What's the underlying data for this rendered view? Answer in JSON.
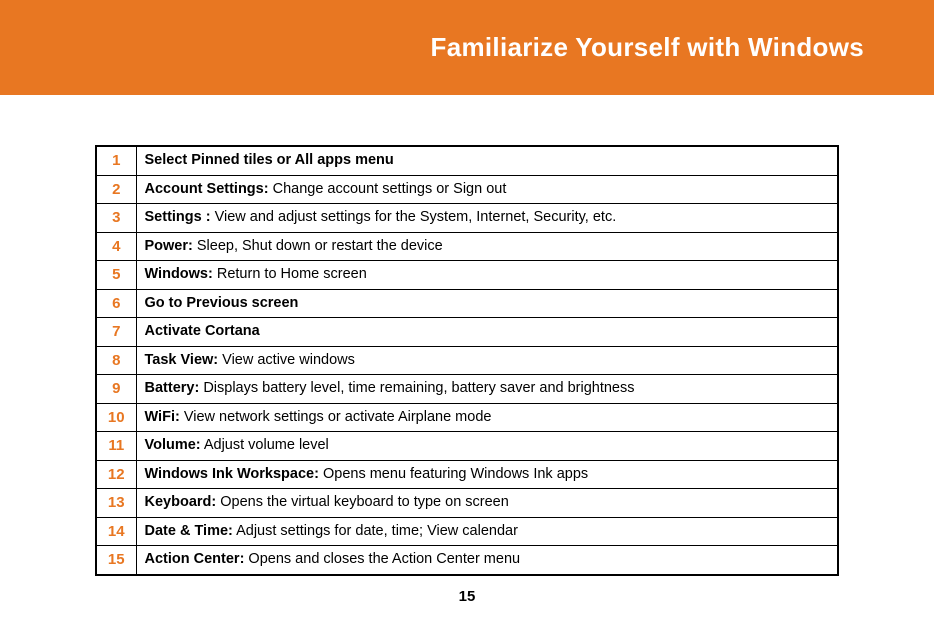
{
  "header": {
    "title": "Familiarize Yourself with Windows"
  },
  "rows": [
    {
      "num": "1",
      "bold": "Select Pinned tiles or All apps menu",
      "rest": ""
    },
    {
      "num": "2",
      "bold": "Account Settings:",
      "rest": " Change account settings or Sign out"
    },
    {
      "num": "3",
      "bold": "Settings :",
      "rest": " View and adjust settings for the System, Internet, Security, etc."
    },
    {
      "num": "4",
      "bold": "Power:",
      "rest": " Sleep, Shut down or restart the device"
    },
    {
      "num": "5",
      "bold": "Windows:",
      "rest": " Return to Home screen"
    },
    {
      "num": "6",
      "bold": "Go to Previous screen",
      "rest": ""
    },
    {
      "num": "7",
      "bold": "Activate Cortana",
      "rest": ""
    },
    {
      "num": "8",
      "bold": "Task View:",
      "rest": " View active windows"
    },
    {
      "num": "9",
      "bold": "Battery:",
      "rest": " Displays battery level, time remaining, battery saver and brightness"
    },
    {
      "num": "10",
      "bold": "WiFi:",
      "rest": " View network settings or activate Airplane mode"
    },
    {
      "num": "11",
      "bold": "Volume:",
      "rest": " Adjust volume level"
    },
    {
      "num": "12",
      "bold": "Windows Ink Workspace:",
      "rest": " Opens menu featuring Windows Ink apps"
    },
    {
      "num": "13",
      "bold": "Keyboard:",
      "rest": " Opens the virtual keyboard to type on screen"
    },
    {
      "num": "14",
      "bold": "Date & Time:",
      "rest": " Adjust settings for date, time; View calendar"
    },
    {
      "num": "15",
      "bold": "Action Center:",
      "rest": " Opens and closes the Action Center menu"
    }
  ],
  "page_number": "15"
}
